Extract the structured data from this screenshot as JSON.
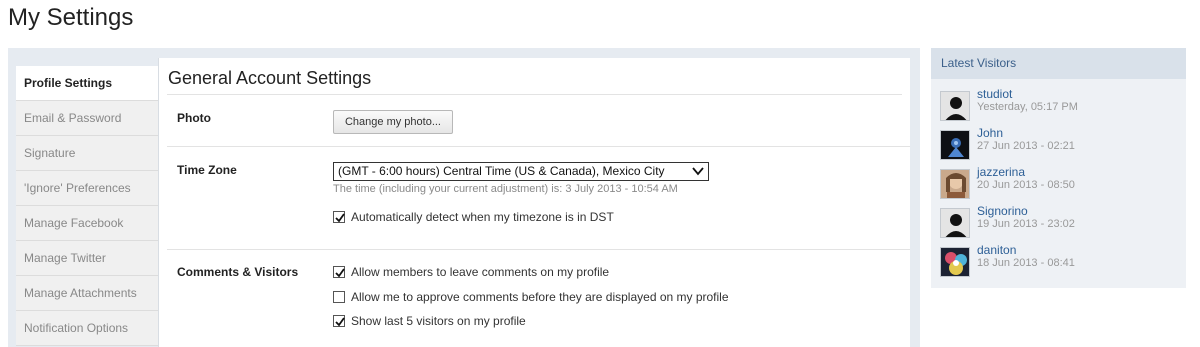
{
  "page": {
    "title": "My Settings"
  },
  "sidebar": {
    "items": [
      {
        "label": "Profile Settings"
      },
      {
        "label": "Email & Password"
      },
      {
        "label": "Signature"
      },
      {
        "label": "'Ignore' Preferences"
      },
      {
        "label": "Manage Facebook"
      },
      {
        "label": "Manage Twitter"
      },
      {
        "label": "Manage Attachments"
      },
      {
        "label": "Notification Options"
      }
    ],
    "active_index": 0
  },
  "content": {
    "title": "General Account Settings",
    "photo": {
      "label": "Photo",
      "button_label": "Change my photo..."
    },
    "timezone": {
      "label": "Time Zone",
      "selected": "(GMT - 6:00 hours) Central Time (US & Canada), Mexico City",
      "hint": "The time (including your current adjustment) is: 3 July 2013 - 10:54 AM",
      "dst_label": "Automatically detect when my timezone is in DST",
      "dst_checked": true
    },
    "comments": {
      "label": "Comments & Visitors",
      "options": [
        {
          "label": "Allow members to leave comments on my profile",
          "checked": true
        },
        {
          "label": "Allow me to approve comments before they are displayed on my profile",
          "checked": false
        },
        {
          "label": "Show last 5 visitors on my profile",
          "checked": true
        }
      ]
    }
  },
  "visitors": {
    "title": "Latest Visitors",
    "list": [
      {
        "name": "studiot",
        "time": "Yesterday, 05:17 PM",
        "avatar": "default-avatar-icon"
      },
      {
        "name": "John",
        "time": "27 Jun 2013 - 02:21",
        "avatar": "blue-figure-avatar"
      },
      {
        "name": "jazzerina",
        "time": "20 Jun 2013 - 08:50",
        "avatar": "photo-avatar"
      },
      {
        "name": "Signorino",
        "time": "19 Jun 2013 - 23:02",
        "avatar": "default-avatar-icon"
      },
      {
        "name": "daniton",
        "time": "18 Jun 2013 - 08:41",
        "avatar": "colorful-avatar"
      }
    ]
  },
  "colors": {
    "accent_link": "#2d5f96",
    "panel_bg": "#e6ebf1",
    "visitors_header": "#d9e1ea"
  }
}
